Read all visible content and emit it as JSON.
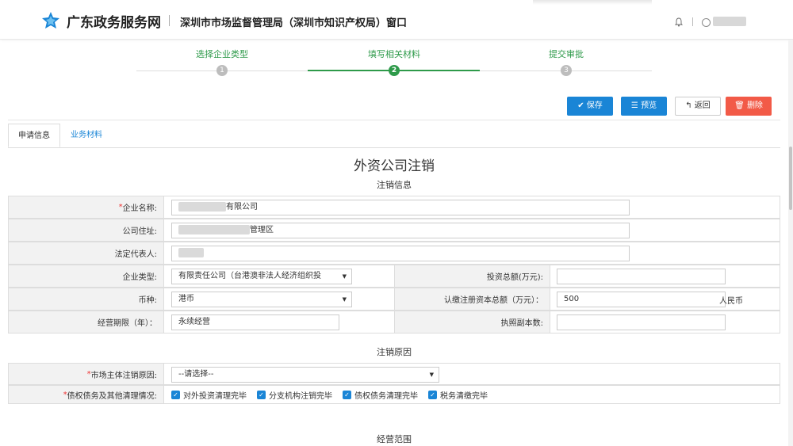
{
  "header": {
    "brand": "广东政务服务网",
    "subtitle": "深圳市市场监督管理局（深圳市知识产权局）窗口"
  },
  "steps": [
    {
      "label": "选择企业类型",
      "number": "1"
    },
    {
      "label": "填写相关材料",
      "number": "2"
    },
    {
      "label": "提交审批",
      "number": "3"
    }
  ],
  "toolbar": {
    "save": "保存",
    "preview": "预览",
    "back": "返回",
    "delete": "删除"
  },
  "tabs": {
    "apply_info": "申请信息",
    "business_materials": "业务材料"
  },
  "page_title": "外资公司注销",
  "sections": {
    "cancel_info": "注销信息",
    "cancel_reason": "注销原因",
    "business_scope": "经营范围"
  },
  "form": {
    "company_name_label": "企业名称:",
    "company_name_value": "有限公司",
    "address_label": "公司住址:",
    "address_value": "管理区",
    "legal_rep_label": "法定代表人:",
    "company_type_label": "企业类型:",
    "company_type_value": "有限责任公司（台港澳非法人经济组织投",
    "investment_label": "投资总额(万元):",
    "currency_label": "币种:",
    "currency_value": "港币",
    "capital_label": "认缴注册资本总额（万元）：",
    "capital_value": "500",
    "capital_unit": "人民币",
    "term_label": "经营期限（年）：",
    "term_value": "永续经营",
    "copies_label": "执照副本数:",
    "reason_label": "市场主体注销原因:",
    "reason_placeholder": "--请选择--",
    "settlement_label": "债权债务及其他清理情况:",
    "checks": [
      "对外投资清理完毕",
      "分支机构注销完毕",
      "债权债务清理完毕",
      "税务清缴完毕"
    ]
  },
  "colors": {
    "accent_blue": "#1a85d6",
    "step_green": "#2e9a4a",
    "delete_red": "#f25a47"
  }
}
